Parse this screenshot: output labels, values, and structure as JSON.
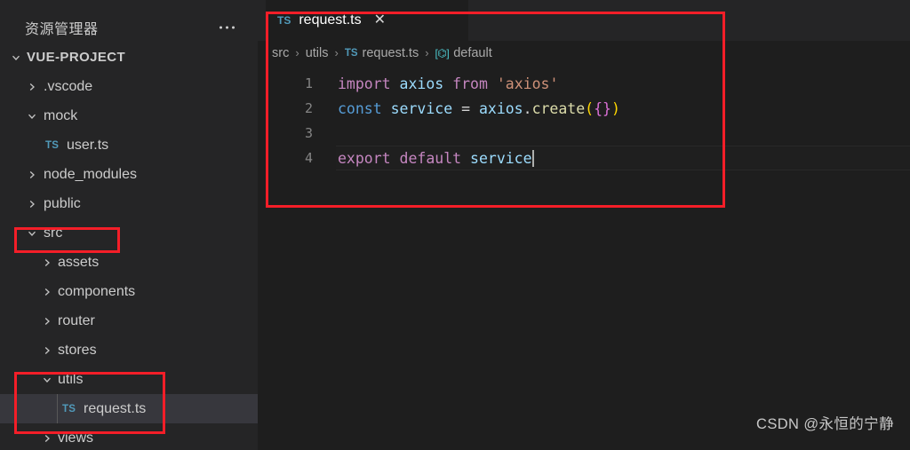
{
  "sidebar": {
    "title": "资源管理器",
    "more_icon": "ellipsis-icon",
    "tree": [
      {
        "label": "VUE-PROJECT",
        "type": "root",
        "state": "expanded",
        "indent": 0
      },
      {
        "label": ".vscode",
        "type": "folder",
        "state": "collapsed",
        "indent": 1
      },
      {
        "label": "mock",
        "type": "folder",
        "state": "expanded",
        "indent": 1
      },
      {
        "label": "user.ts",
        "type": "file",
        "badge": "TS",
        "indent": 2
      },
      {
        "label": "node_modules",
        "type": "folder",
        "state": "collapsed",
        "indent": 1
      },
      {
        "label": "public",
        "type": "folder",
        "state": "collapsed",
        "indent": 1
      },
      {
        "label": "src",
        "type": "folder",
        "state": "expanded",
        "indent": 1
      },
      {
        "label": "assets",
        "type": "folder",
        "state": "collapsed",
        "indent": 2
      },
      {
        "label": "components",
        "type": "folder",
        "state": "collapsed",
        "indent": 2
      },
      {
        "label": "router",
        "type": "folder",
        "state": "collapsed",
        "indent": 2
      },
      {
        "label": "stores",
        "type": "folder",
        "state": "collapsed",
        "indent": 2
      },
      {
        "label": "utils",
        "type": "folder",
        "state": "expanded",
        "indent": 2
      },
      {
        "label": "request.ts",
        "type": "file",
        "badge": "TS",
        "indent": 3,
        "selected": true
      },
      {
        "label": "views",
        "type": "folder",
        "state": "collapsed",
        "indent": 2
      }
    ]
  },
  "editor": {
    "tab": {
      "badge": "TS",
      "name": "request.ts",
      "close_icon": "✕"
    },
    "breadcrumb": {
      "parts": [
        "src",
        "utils",
        "request.ts",
        "default"
      ],
      "file_badge": "TS",
      "symbol_icon": "[⌬]",
      "separator": "›"
    },
    "lines": [
      {
        "no": "1"
      },
      {
        "no": "2"
      },
      {
        "no": "3"
      },
      {
        "no": "4",
        "current": true
      }
    ],
    "code": {
      "l1": {
        "import": "import",
        "axios": " axios ",
        "from": "from",
        "module": " 'axios'"
      },
      "l2": {
        "const": "const",
        "service": " service ",
        "eq": "=",
        "axios": " axios",
        "dot": ".",
        "create": "create",
        "open_paren": "(",
        "open_brace": "{",
        "close_brace": "}",
        "close_paren": ")"
      },
      "l3": {
        "empty": ""
      },
      "l4": {
        "export_default": "export default",
        "service": " service"
      }
    }
  },
  "annotations": {
    "editor_box": "highlight-editor-panel",
    "src_box": "highlight-src-folder",
    "utils_box": "highlight-utils-folder",
    "color": "#f41e28"
  },
  "watermark": {
    "text": "CSDN @永恒的宁静"
  }
}
